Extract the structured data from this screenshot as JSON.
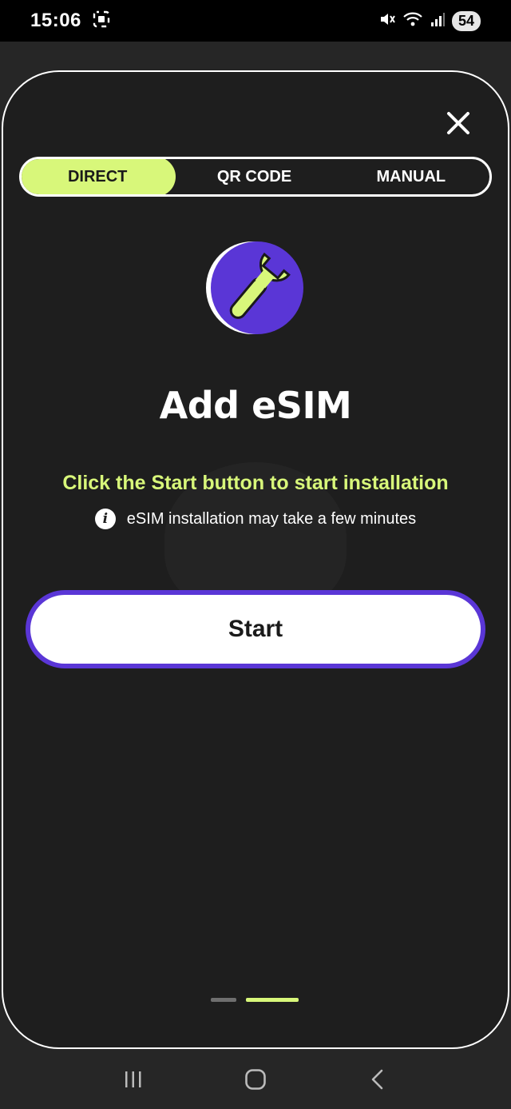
{
  "status_bar": {
    "time": "15:06",
    "battery": "54",
    "icons": [
      "screenshot-icon",
      "mute-icon",
      "wifi-icon",
      "signal-icon"
    ]
  },
  "tabs": [
    {
      "label": "DIRECT",
      "active": true
    },
    {
      "label": "QR CODE",
      "active": false
    },
    {
      "label": "MANUAL",
      "active": false
    }
  ],
  "content": {
    "title": "Add eSIM",
    "instruction": "Click the Start button to start installation",
    "note": "eSIM installation may take a few minutes",
    "start_label": "Start"
  },
  "pagination": {
    "current": 2,
    "total": 2
  },
  "colors": {
    "accent": "#d8f77a",
    "brand_purple": "#5a36d6",
    "background": "#1e1e1e"
  },
  "nav_icons": [
    "recents-icon",
    "home-icon",
    "back-icon"
  ]
}
